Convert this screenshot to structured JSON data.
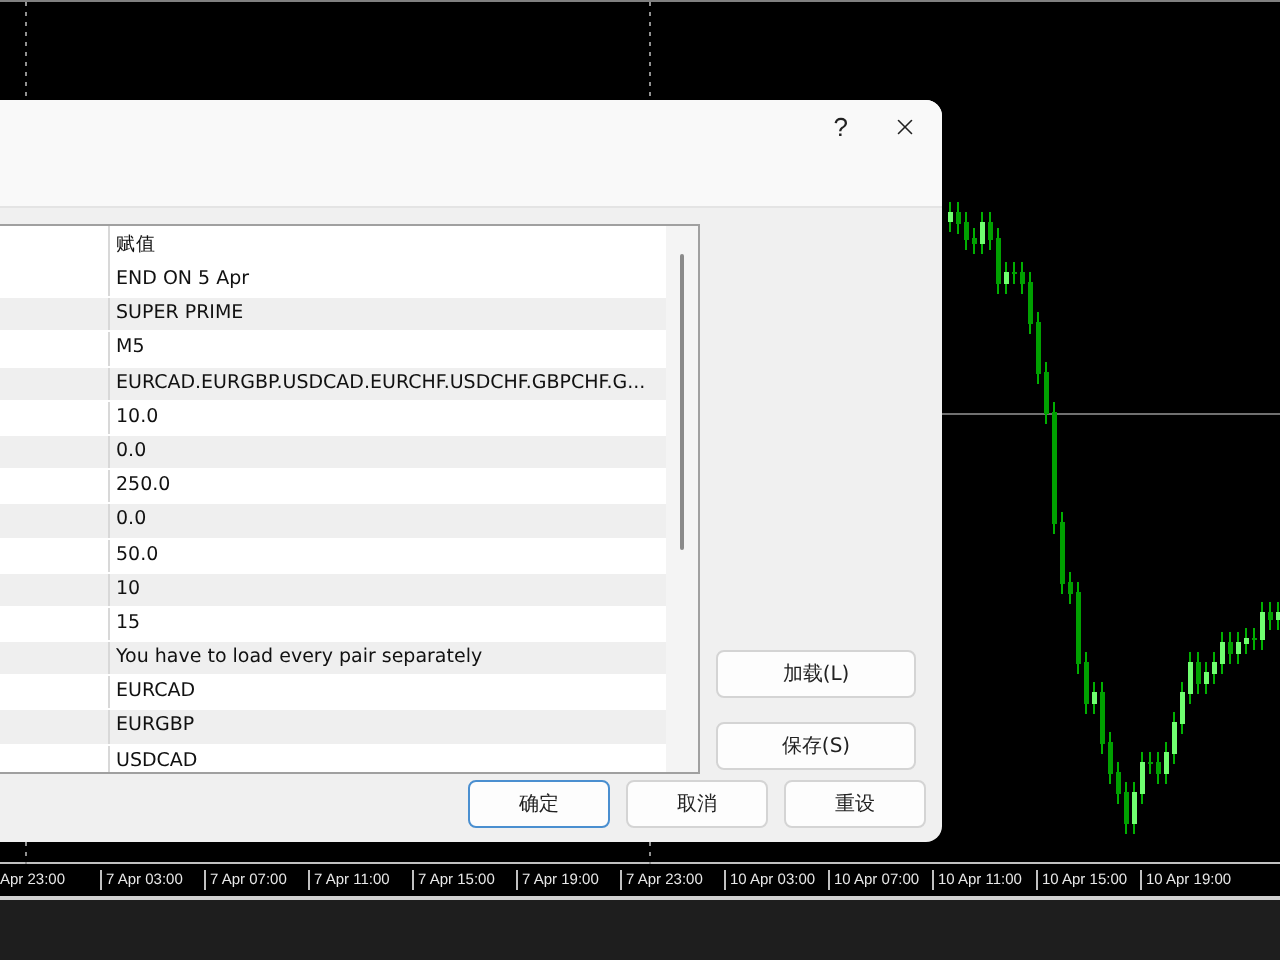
{
  "chart": {
    "time_axis": [
      "Apr 23:00",
      "7 Apr 03:00",
      "7 Apr 07:00",
      "7 Apr 11:00",
      "7 Apr 15:00",
      "7 Apr 19:00",
      "7 Apr 23:00",
      "10 Apr 03:00",
      "10 Apr 07:00",
      "10 Apr 11:00",
      "10 Apr 15:00",
      "10 Apr 19:00"
    ]
  },
  "dialog": {
    "help": "?",
    "table": {
      "header": "赋值",
      "rows": [
        "END ON 5 Apr",
        "SUPER PRIME",
        "M5",
        "EURCAD.EURGBP.USDCAD.EURCHF.USDCHF.GBPCHF.G...",
        "10.0",
        "0.0",
        "250.0",
        "0.0",
        "50.0",
        "10",
        "15",
        "You have to load every pair separately",
        "EURCAD",
        "EURGBP",
        "USDCAD"
      ]
    },
    "side_buttons": [
      "加载(L)",
      "保存(S)"
    ],
    "buttons": [
      {
        "label": "确定",
        "default": true
      },
      {
        "label": "取消",
        "default": false
      },
      {
        "label": "重设",
        "default": false
      }
    ]
  }
}
